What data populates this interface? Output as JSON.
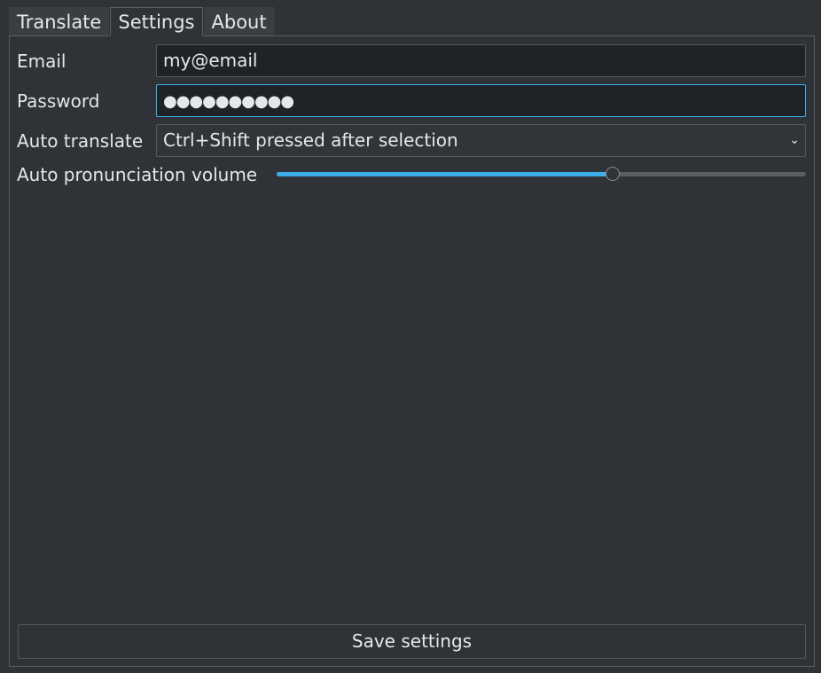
{
  "tabs": [
    {
      "label": "Translate",
      "active": false
    },
    {
      "label": "Settings",
      "active": true
    },
    {
      "label": "About",
      "active": false
    }
  ],
  "settings": {
    "email": {
      "label": "Email",
      "value": "my@email"
    },
    "password": {
      "label": "Password",
      "value": "●●●●●●●●●●"
    },
    "auto_translate": {
      "label": "Auto translate",
      "selected": "Ctrl+Shift pressed after selection"
    },
    "volume": {
      "label": "Auto pronunciation volume",
      "level": 0.635
    },
    "save_label": "Save settings"
  },
  "colors": {
    "accent": "#3daee9",
    "background": "#2f3237",
    "field_background": "#202326"
  }
}
